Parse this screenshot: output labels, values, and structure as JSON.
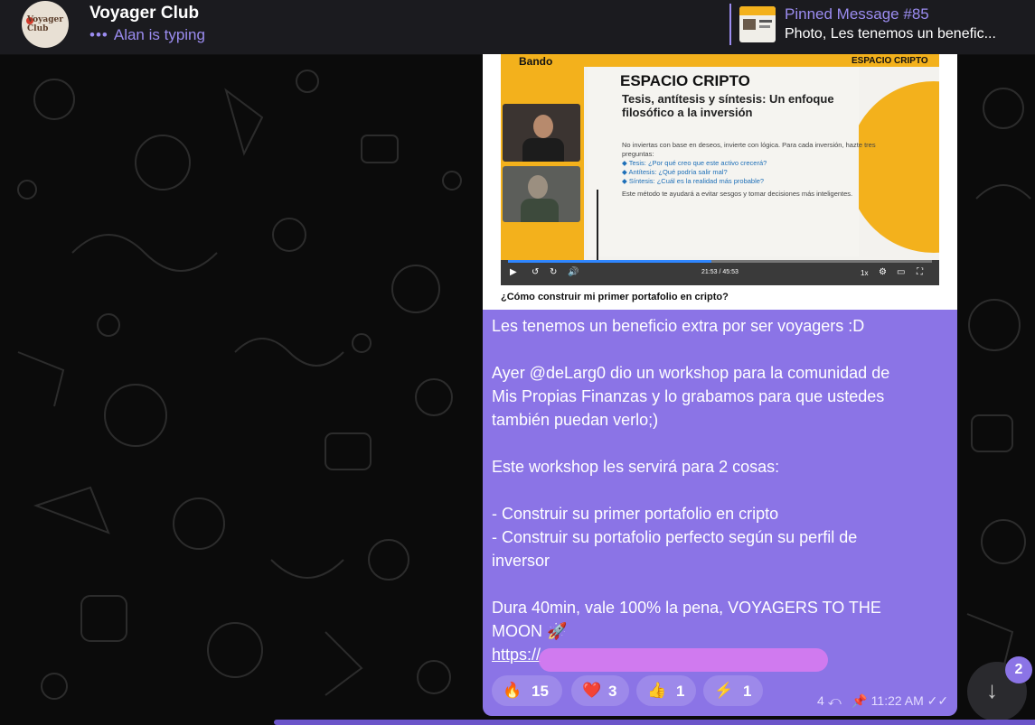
{
  "header": {
    "title": "Voyager Club",
    "typing_dots": "•••",
    "typing": "Alan is typing",
    "avatar_text": "Voyager Club"
  },
  "pinned": {
    "title": "Pinned Message #85",
    "text": "Photo, Les tenemos un benefic..."
  },
  "media": {
    "brand": "Bando",
    "slide_header": "ESPACIO CRIPTO",
    "slide_title": "ESPACIO CRIPTO",
    "slide_subtitle": "Tesis, antítesis y síntesis: Un enfoque filosófico a la inversión",
    "slide_intro": "No inviertas con base en deseos, invierte con lógica. Para cada inversión, hazte tres preguntas:",
    "slide_points": [
      "◆ Tesis: ¿Por qué creo que este activo crecerá?",
      "◆ Antítesis: ¿Qué podría salir mal?",
      "◆ Síntesis: ¿Cuál es la realidad más probable?"
    ],
    "slide_outro": "Este método te ayudará a evitar sesgos y tomar decisiones más inteligentes.",
    "time": "21:53 / 45:53",
    "progress": 0.48,
    "speed": "1x",
    "caption": "¿Cómo construir mi primer portafolio en cripto?"
  },
  "message": {
    "lines": [
      "Les tenemos un beneficio extra por ser voyagers :D",
      "",
      "Ayer @deLarg0 dio un workshop para la comunidad de",
      "Mis Propias Finanzas y lo grabamos para que ustedes",
      "también puedan verlo;)",
      "",
      "Este workshop les servirá para 2 cosas:",
      "",
      "- Construir su primer portafolio en cripto",
      "- Construir su portafolio perfecto según su perfil de",
      "inversor",
      "",
      "Dura 40min, vale 100% la pena, VOYAGERS TO THE",
      "MOON 🚀"
    ],
    "link": "https://"
  },
  "reactions": [
    {
      "emoji": "🔥",
      "count": "15"
    },
    {
      "emoji": "❤️",
      "count": "3"
    },
    {
      "emoji": "👍",
      "count": "1"
    },
    {
      "emoji": "⚡",
      "count": "1"
    }
  ],
  "meta": {
    "replies": "4",
    "time": "11:22 AM"
  },
  "scroll": {
    "badge": "2"
  },
  "colors": {
    "accent": "#9b8cf0",
    "bubble": "#8b74e6",
    "header": "#1b1b1f",
    "slide_orange": "#f3b11c"
  }
}
